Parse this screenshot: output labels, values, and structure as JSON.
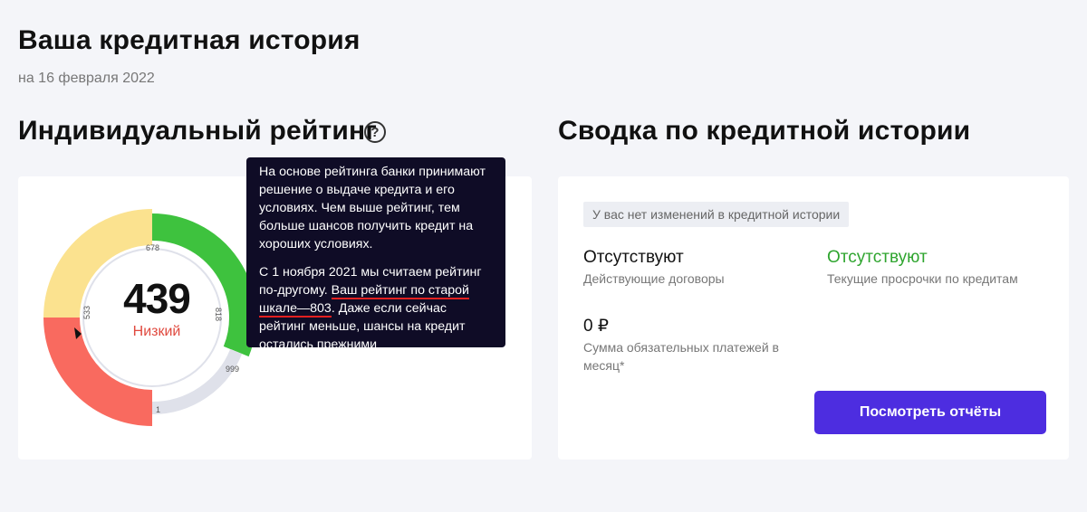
{
  "header": {
    "title": "Ваша кредитная история",
    "date": "на 16 февраля 2022"
  },
  "rating": {
    "title": "Индивидуальный рейтинг",
    "help_icon": "question-circle-icon",
    "score": "439",
    "level": "Низкий",
    "gauge_value": 439,
    "gauge_max": 999,
    "scale_labels": {
      "min": "1",
      "low": "533",
      "mid": "678",
      "high": "818",
      "max": "999"
    },
    "colors": {
      "red": "#f96a5f",
      "yellow": "#fbe28f",
      "green": "#3ec23e",
      "track": "#dfe1ea"
    }
  },
  "tooltip": {
    "para1": "На основе рейтинга банки принимают решение о выдаче кредита и его условиях. Чем выше рейтинг, тем больше шансов получить кредит на хороших условиях.",
    "para2_start": "С 1 ноября 2021 мы считаем рейтинг по-другому.",
    "para2_highlight": "Ваш рейтинг по старой шкале—803",
    "para2_end": ". Даже если сейчас рейтинг меньше, шансы на кредит остались прежними"
  },
  "summary": {
    "title": "Сводка по кредитной истории",
    "badge": "У вас нет изменений в кредитной истории",
    "contracts_value": "Отсутствуют",
    "contracts_label": "Действующие договоры",
    "overdue_value": "Отсутствуют",
    "overdue_label": "Текущие просрочки по кредитам",
    "payments_value": "0 ₽",
    "payments_label": "Сумма обязательных платежей в месяц*",
    "button_label": "Посмотреть отчёты"
  }
}
